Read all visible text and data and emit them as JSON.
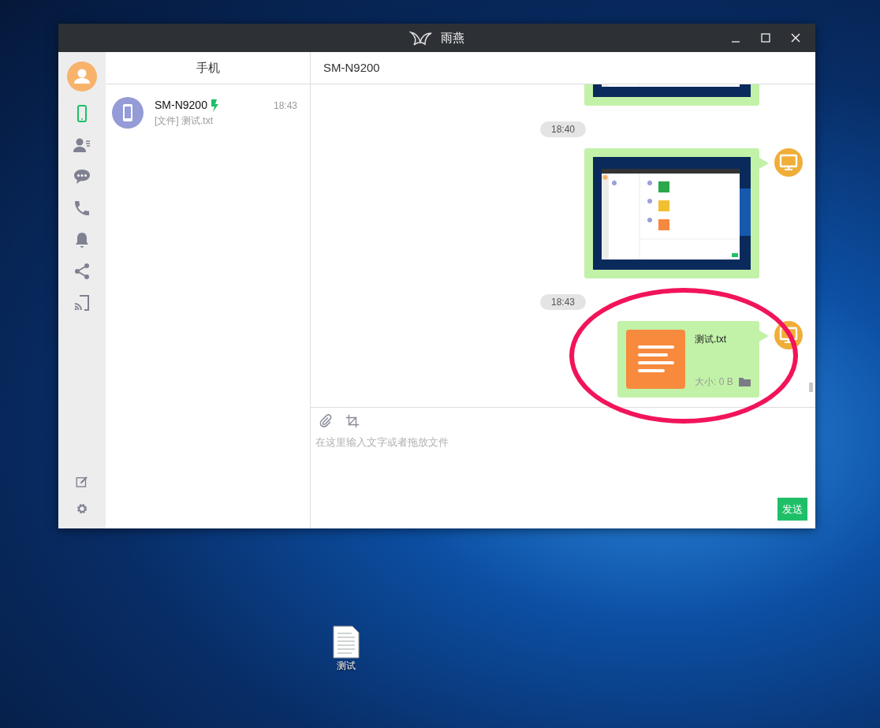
{
  "window": {
    "title": "雨燕"
  },
  "sidebar": {
    "nav_items": [
      {
        "kind": "phone",
        "selected": true
      },
      {
        "kind": "contacts",
        "selected": false
      },
      {
        "kind": "messages",
        "selected": false
      },
      {
        "kind": "calls",
        "selected": false
      },
      {
        "kind": "notifications",
        "selected": false
      },
      {
        "kind": "share",
        "selected": false
      },
      {
        "kind": "cast",
        "selected": false
      }
    ],
    "bottom_items": [
      {
        "kind": "edit"
      },
      {
        "kind": "settings"
      }
    ]
  },
  "contacts": {
    "header": "手机",
    "items": [
      {
        "name": "SM-N9200",
        "charging": true,
        "time": "18:43",
        "preview": "[文件] 测试.txt"
      }
    ]
  },
  "chat": {
    "title": "SM-N9200",
    "messages": [
      {
        "kind": "image",
        "avatar": false
      },
      {
        "kind": "time",
        "text": "18:40"
      },
      {
        "kind": "image",
        "avatar": true
      },
      {
        "kind": "time",
        "text": "18:43"
      },
      {
        "kind": "file",
        "avatar": true,
        "file_name": "测试.txt",
        "size": "大小: 0 B"
      }
    ],
    "input": {
      "placeholder": "在这里输入文字或者拖放文件"
    },
    "send_button": "发送"
  },
  "annotation": {
    "kind": "ellipse",
    "color": "#f2145a"
  },
  "desktop": {
    "icons": [
      {
        "kind": "text-file",
        "label": "测试"
      }
    ]
  }
}
